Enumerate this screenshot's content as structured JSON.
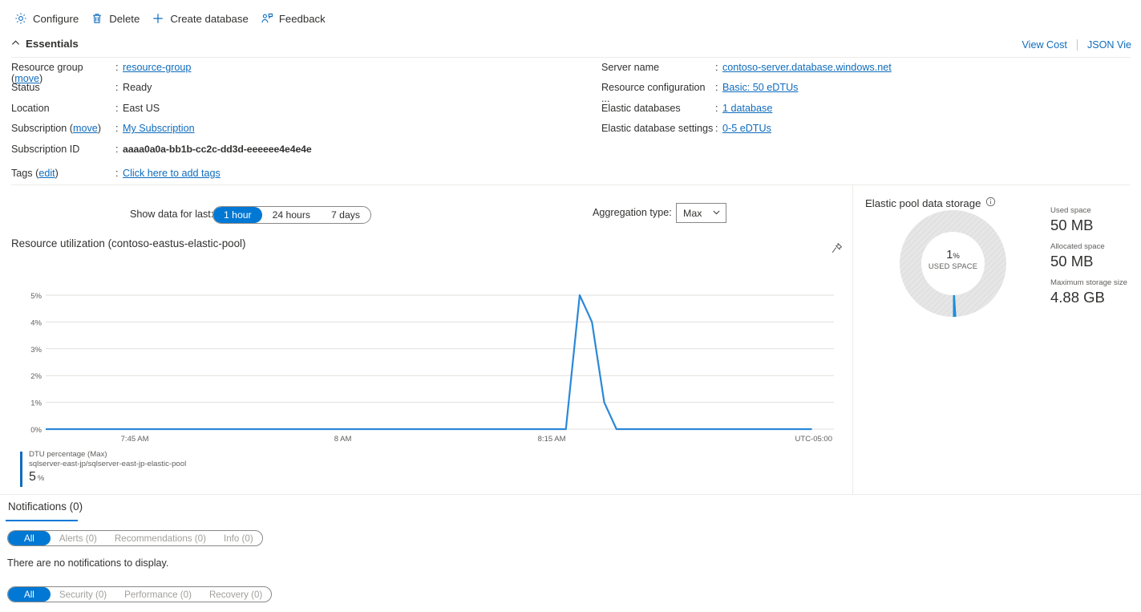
{
  "toolbar": {
    "items": [
      {
        "label": "Configure",
        "icon": "gear-icon"
      },
      {
        "label": "Delete",
        "icon": "trash-icon"
      },
      {
        "label": "Create database",
        "icon": "plus-icon"
      },
      {
        "label": "Feedback",
        "icon": "feedback-icon"
      }
    ]
  },
  "essentials": {
    "header": "Essentials",
    "collapse_icon": "chevron-up-icon",
    "view_cost": "View Cost",
    "json_view": "JSON Vie",
    "left": [
      {
        "key": "Resource group",
        "key_action": "move",
        "colon": ":",
        "value": "resource-group",
        "is_link": true
      },
      {
        "key": "Status",
        "key_action": "",
        "colon": ":",
        "value": "Ready",
        "is_link": false
      },
      {
        "key": "Location",
        "key_action": "",
        "colon": ":",
        "value": "East US",
        "is_link": false
      },
      {
        "key": "Subscription",
        "key_action": "move",
        "colon": ":",
        "value": "My Subscription",
        "is_link": true
      },
      {
        "key": "Subscription ID",
        "key_action": "",
        "colon": ":",
        "value": "aaaa0a0a-bb1b-cc2c-dd3d-eeeeee4e4e4e",
        "is_link": false
      },
      {
        "key": "Tags",
        "key_action": "edit",
        "colon": ":",
        "value": "Click here to add tags",
        "is_link": true
      }
    ],
    "right": [
      {
        "key": "Server name",
        "colon": ":",
        "value": "contoso-server.database.windows.net",
        "is_link": true
      },
      {
        "key": "Resource configuration ...",
        "colon": ":",
        "value": "Basic: 50 eDTUs",
        "is_link": true
      },
      {
        "key": "Elastic databases",
        "colon": ":",
        "value": "1 database",
        "is_link": true
      },
      {
        "key": "Elastic database settings",
        "colon": ":",
        "value": "0-5 eDTUs",
        "is_link": true
      }
    ]
  },
  "controls": {
    "show_data_label": "Show data for last:",
    "time_ranges": [
      "1 hour",
      "24 hours",
      "7 days"
    ],
    "time_range_selected": "1 hour",
    "aggregation_label": "Aggregation type:",
    "aggregation_value": "Max",
    "aggregation_chevron": "chevron-down-icon"
  },
  "chart_panel": {
    "title": "Resource utilization (contoso-eastus-elastic-pool)",
    "pin_icon": "pin-icon"
  },
  "chart_data": {
    "type": "line",
    "title": "Resource utilization (contoso-eastus-elastic-pool)",
    "xlabel": "",
    "ylabel": "",
    "timezone": "UTC-05:00",
    "ylim": [
      0,
      5
    ],
    "ytick_labels": [
      "5%",
      "4%",
      "3%",
      "2%",
      "1%",
      "0%"
    ],
    "ytick_values": [
      5,
      4,
      3,
      2,
      1,
      0
    ],
    "xtick_labels": [
      "7:45 AM",
      "8 AM",
      "8:15 AM"
    ],
    "xtick_positions": [
      0.113,
      0.377,
      0.642
    ],
    "grid": true,
    "legend_position": "bottom-left",
    "line_color": "#2b88d8",
    "series": [
      {
        "name": "DTU percentage (Max)",
        "resource": "sqlserver-east-jp/sqlserver-east-jp-elastic-pool",
        "current_value": "5",
        "current_unit": "%",
        "x": [
          0.0,
          0.25,
          0.55,
          0.66,
          0.679,
          0.697,
          0.713,
          0.729,
          0.745,
          0.76,
          0.85,
          1.0
        ],
        "values": [
          0,
          0,
          0,
          0,
          0,
          5,
          4,
          1,
          0,
          0,
          0,
          0
        ]
      }
    ]
  },
  "storage_panel": {
    "title": "Elastic pool data storage",
    "info_icon": "info-icon",
    "donut_center_value": "1",
    "donut_center_percent": "%",
    "donut_center_label": "USED SPACE",
    "donut_used_fraction": 1,
    "stats": [
      {
        "label": "Used space",
        "value": "50 MB"
      },
      {
        "label": "Allocated space",
        "value": "50 MB"
      },
      {
        "label": "Maximum storage size",
        "value": "4.88 GB"
      }
    ]
  },
  "notifications": {
    "tab_label": "Notifications (0)",
    "filters_row1": [
      "All",
      "Alerts (0)",
      "Recommendations (0)",
      "Info (0)"
    ],
    "filters_row1_selected": "All",
    "empty_message": "There are no notifications to display.",
    "filters_row2": [
      "All",
      "Security (0)",
      "Performance (0)",
      "Recovery (0)"
    ],
    "filters_row2_selected": "All"
  },
  "colors": {
    "accent": "#0078d4",
    "link": "#0f6cbd",
    "line": "#2b88d8",
    "muted": "#605e5c"
  }
}
